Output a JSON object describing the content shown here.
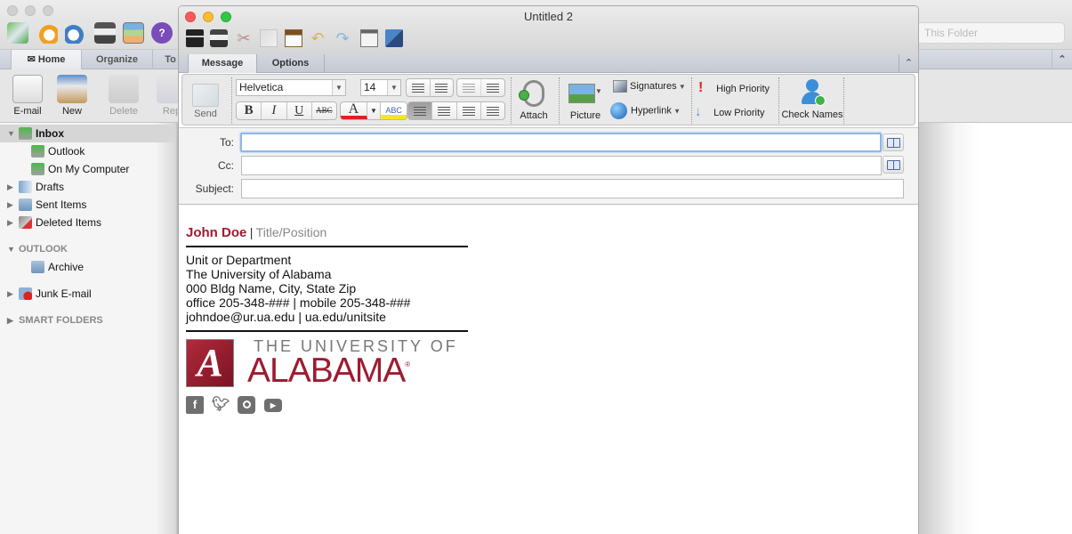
{
  "main_window": {
    "tabs": [
      {
        "label": "Home",
        "active": true
      },
      {
        "label": "Organize",
        "active": false
      },
      {
        "label": "To",
        "active": false
      }
    ],
    "ribbon": [
      {
        "label": "E-mail",
        "icon": "new-email-icon"
      },
      {
        "label": "New",
        "icon": "new-item-icon"
      },
      {
        "label": "Delete",
        "icon": "delete-trash-icon",
        "disabled": true
      },
      {
        "label": "Rep",
        "icon": "reply-icon",
        "disabled": true
      }
    ],
    "search_placeholder": "This Folder",
    "sidebar": {
      "inbox": "Inbox",
      "inbox_children": [
        "Outlook",
        "On My Computer"
      ],
      "folders": [
        "Drafts",
        "Sent Items",
        "Deleted Items"
      ],
      "section_outlook": "OUTLOOK",
      "archive": "Archive",
      "junk": "Junk E-mail",
      "smart_folders": "SMART FOLDERS"
    }
  },
  "compose": {
    "title": "Untitled 2",
    "tabs": [
      {
        "label": "Message",
        "active": true
      },
      {
        "label": "Options",
        "active": false
      }
    ],
    "ribbon": {
      "send": "Send",
      "font": "Helvetica",
      "size": "14",
      "bold": "B",
      "italic": "I",
      "underline": "U",
      "strike": "ABC",
      "font_color": "A",
      "highlight": "ABC",
      "attach": "Attach",
      "picture": "Picture",
      "signatures": "Signatures",
      "hyperlink": "Hyperlink",
      "high_priority": "High Priority",
      "low_priority": "Low Priority",
      "check_names": "Check Names",
      "colors": {
        "font_color": "#e02020",
        "highlight": "#f5e52a"
      }
    },
    "header": {
      "to_label": "To:",
      "cc_label": "Cc:",
      "subject_label": "Subject:",
      "to_value": "",
      "cc_value": "",
      "subject_value": ""
    },
    "signature": {
      "name": "John Doe",
      "separator": "|",
      "title": "Title/Position",
      "lines": [
        "Unit or Department",
        "The University of Alabama",
        "000 Bldg Name, City, State Zip",
        "office 205-348-### | mobile 205-348-###",
        "johndoe@ur.ua.edu | ua.edu/unitsite"
      ],
      "logo_mark": "A",
      "logo_line1": "THE UNIVERSITY OF",
      "logo_line2": "ALABAMA",
      "logo_reg": "®",
      "brand_color": "#9e1b32",
      "social": [
        {
          "icon": "facebook-icon",
          "glyph": "f"
        },
        {
          "icon": "twitter-icon",
          "glyph": "t"
        },
        {
          "icon": "instagram-icon",
          "glyph": "◘"
        },
        {
          "icon": "youtube-icon",
          "glyph": "▶"
        }
      ]
    }
  }
}
